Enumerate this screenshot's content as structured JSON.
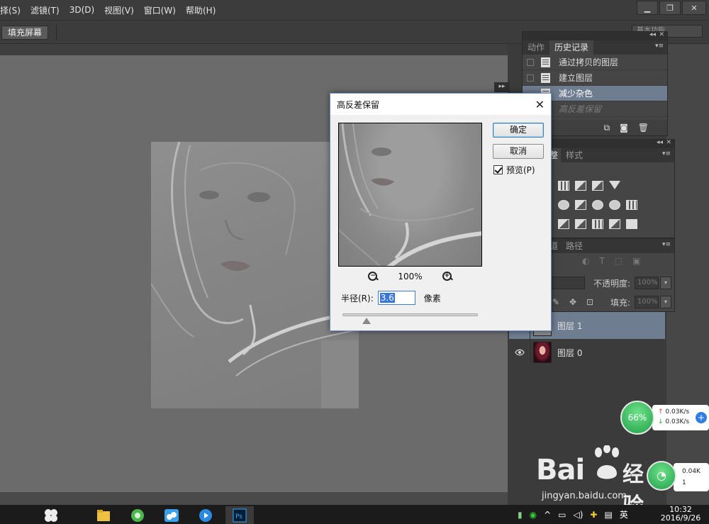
{
  "menu": {
    "items": [
      "择(S)",
      "滤镜(T)",
      "3D(D)",
      "视图(V)",
      "窗口(W)",
      "帮助(H)"
    ]
  },
  "window_controls": {
    "minimize": "▁",
    "restore": "❐",
    "close": "✕"
  },
  "options_bar": {
    "fill_screen_button": "填充屏幕",
    "workspace": "基本功能"
  },
  "history_panel": {
    "tabs": [
      "动作",
      "历史记录"
    ],
    "active_tab": "历史记录",
    "items": [
      {
        "label": "通过拷贝的图层",
        "state": "normal"
      },
      {
        "label": "建立图层",
        "state": "normal"
      },
      {
        "label": "减少杂色",
        "state": "selected"
      },
      {
        "label": "高反差保留",
        "state": "future"
      }
    ]
  },
  "adjustments_panel": {
    "tab_partial": "整",
    "styles_tab": "样式"
  },
  "layers_panel": {
    "tab_partial": "道",
    "paths_tab": "路径",
    "opacity_label": "不透明度:",
    "opacity_value": "100%",
    "fill_label": "填充:",
    "fill_value": "100%",
    "layers": [
      {
        "name": "图层 1",
        "selected": true,
        "visible": false
      },
      {
        "name": "图层 0",
        "selected": false,
        "visible": true
      }
    ]
  },
  "dialog": {
    "title": "高反差保留",
    "ok_button": "确定",
    "cancel_button": "取消",
    "preview_label": "预览(P)",
    "preview_checked": true,
    "zoom_level": "100%",
    "radius_label": "半径(R):",
    "radius_value": "3.6",
    "unit_label": "像素",
    "slider_position": 0.18
  },
  "network_widget": {
    "percent": "66%",
    "upload": "0.03K/s",
    "download": "0.03K/s",
    "secondary_rate": "0.04K",
    "secondary_count": "1"
  },
  "watermark": {
    "logo_text": "Bai",
    "logo_text2": "经验",
    "url": "jingyan.baidu.com"
  },
  "taskbar": {
    "ime_label": "英",
    "time": "10:32",
    "date": "2016/9/26"
  },
  "colors": {
    "ps_bg": "#535353",
    "selected_row": "#6f7d91",
    "dialog_bg": "#f0f0f0",
    "net_green": "#1fa24a"
  }
}
